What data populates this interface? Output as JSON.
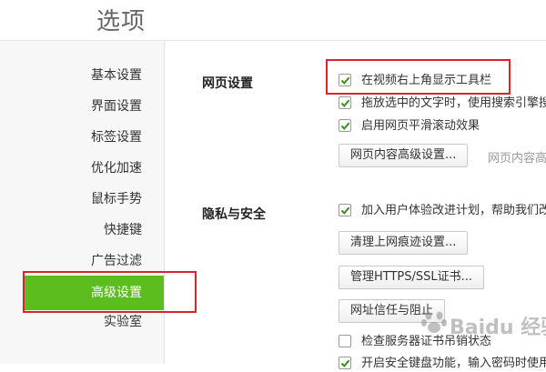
{
  "page": {
    "title": "选项"
  },
  "sidebar": {
    "items": [
      {
        "label": "基本设置"
      },
      {
        "label": "界面设置"
      },
      {
        "label": "标签设置"
      },
      {
        "label": "优化加速"
      },
      {
        "label": "鼠标手势"
      },
      {
        "label": "快捷键"
      },
      {
        "label": "广告过滤"
      },
      {
        "label": "高级设置",
        "active": true
      },
      {
        "label": "实验室"
      }
    ]
  },
  "web_settings": {
    "title": "网页设置",
    "options": [
      {
        "label": "在视频右上角显示工具栏",
        "checked": true
      },
      {
        "label": "拖放选中的文字时，使用搜索引擎搜",
        "checked": true
      },
      {
        "label": "启用网页平滑滚动效果",
        "checked": true
      }
    ],
    "advanced_button": "网页内容高级设置...",
    "advanced_hint": "网页内容高"
  },
  "privacy": {
    "title": "隐私与安全",
    "ux_option": {
      "label": "加入用户体验改进计划，帮助我们改",
      "checked": true
    },
    "clear_button": "清理上网痕迹设置...",
    "ssl_button": "管理HTTPS/SSL证书...",
    "trust_button": "网址信任与阻止",
    "revocation_option": {
      "label": "检查服务器证书吊销状态",
      "checked": false
    },
    "secure_keyboard_option": {
      "label": "开启安全键盘功能，输入密码时使用",
      "checked": true
    }
  },
  "watermark": {
    "text": "Baidu 经验"
  },
  "colors": {
    "accent": "#5cbd1f",
    "highlight_border": "#d9252a",
    "check": "#3d8f1a"
  }
}
